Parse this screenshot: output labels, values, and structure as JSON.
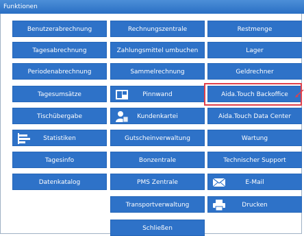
{
  "window": {
    "title": "Funktionen"
  },
  "buttons": {
    "benutzerabrechnung": "Benutzerabrechnung",
    "rechnungszentrale": "Rechnungszentrale",
    "restmenge": "Restmenge",
    "tagesabrechnung": "Tagesabrechnung",
    "zahlungsmittel_umbuchen": "Zahlungsmittel umbuchen",
    "lager": "Lager",
    "periodenabrechnung": "Periodenabrechnung",
    "sammelrechnung": "Sammelrechnung",
    "geldrechner": "Geldrechner",
    "tagesumsaetze": "Tagesumsätze",
    "pinnwand": "Pinnwand",
    "aida_touch_backoffice": "Aida.Touch Backoffice",
    "tischuebergabe": "Tischübergabe",
    "kundenkartei": "Kundenkartei",
    "aida_touch_data_center": "Aida.Touch Data Center",
    "statistiken": "Statistiken",
    "gutscheinverwaltung": "Gutscheinverwaltung",
    "wartung": "Wartung",
    "tagesinfo": "Tagesinfo",
    "bonzentrale": "Bonzentrale",
    "technischer_support": "Technischer Support",
    "datenkatalog": "Datenkatalog",
    "pms_zentrale": "PMS Zentrale",
    "email": "E-Mail",
    "transportverwaltung": "Transportverwaltung",
    "drucken": "Drucken",
    "schliessen": "Schließen"
  },
  "icons": {
    "pinnwand": "pinboard-icon",
    "kundenkartei": "customer-file-icon",
    "statistiken": "statistics-icon",
    "email": "mail-icon",
    "drucken": "printer-icon"
  },
  "colors": {
    "button": "#2e72c8",
    "titlebar": "#2a6fc4",
    "highlight": "#e0404a"
  }
}
